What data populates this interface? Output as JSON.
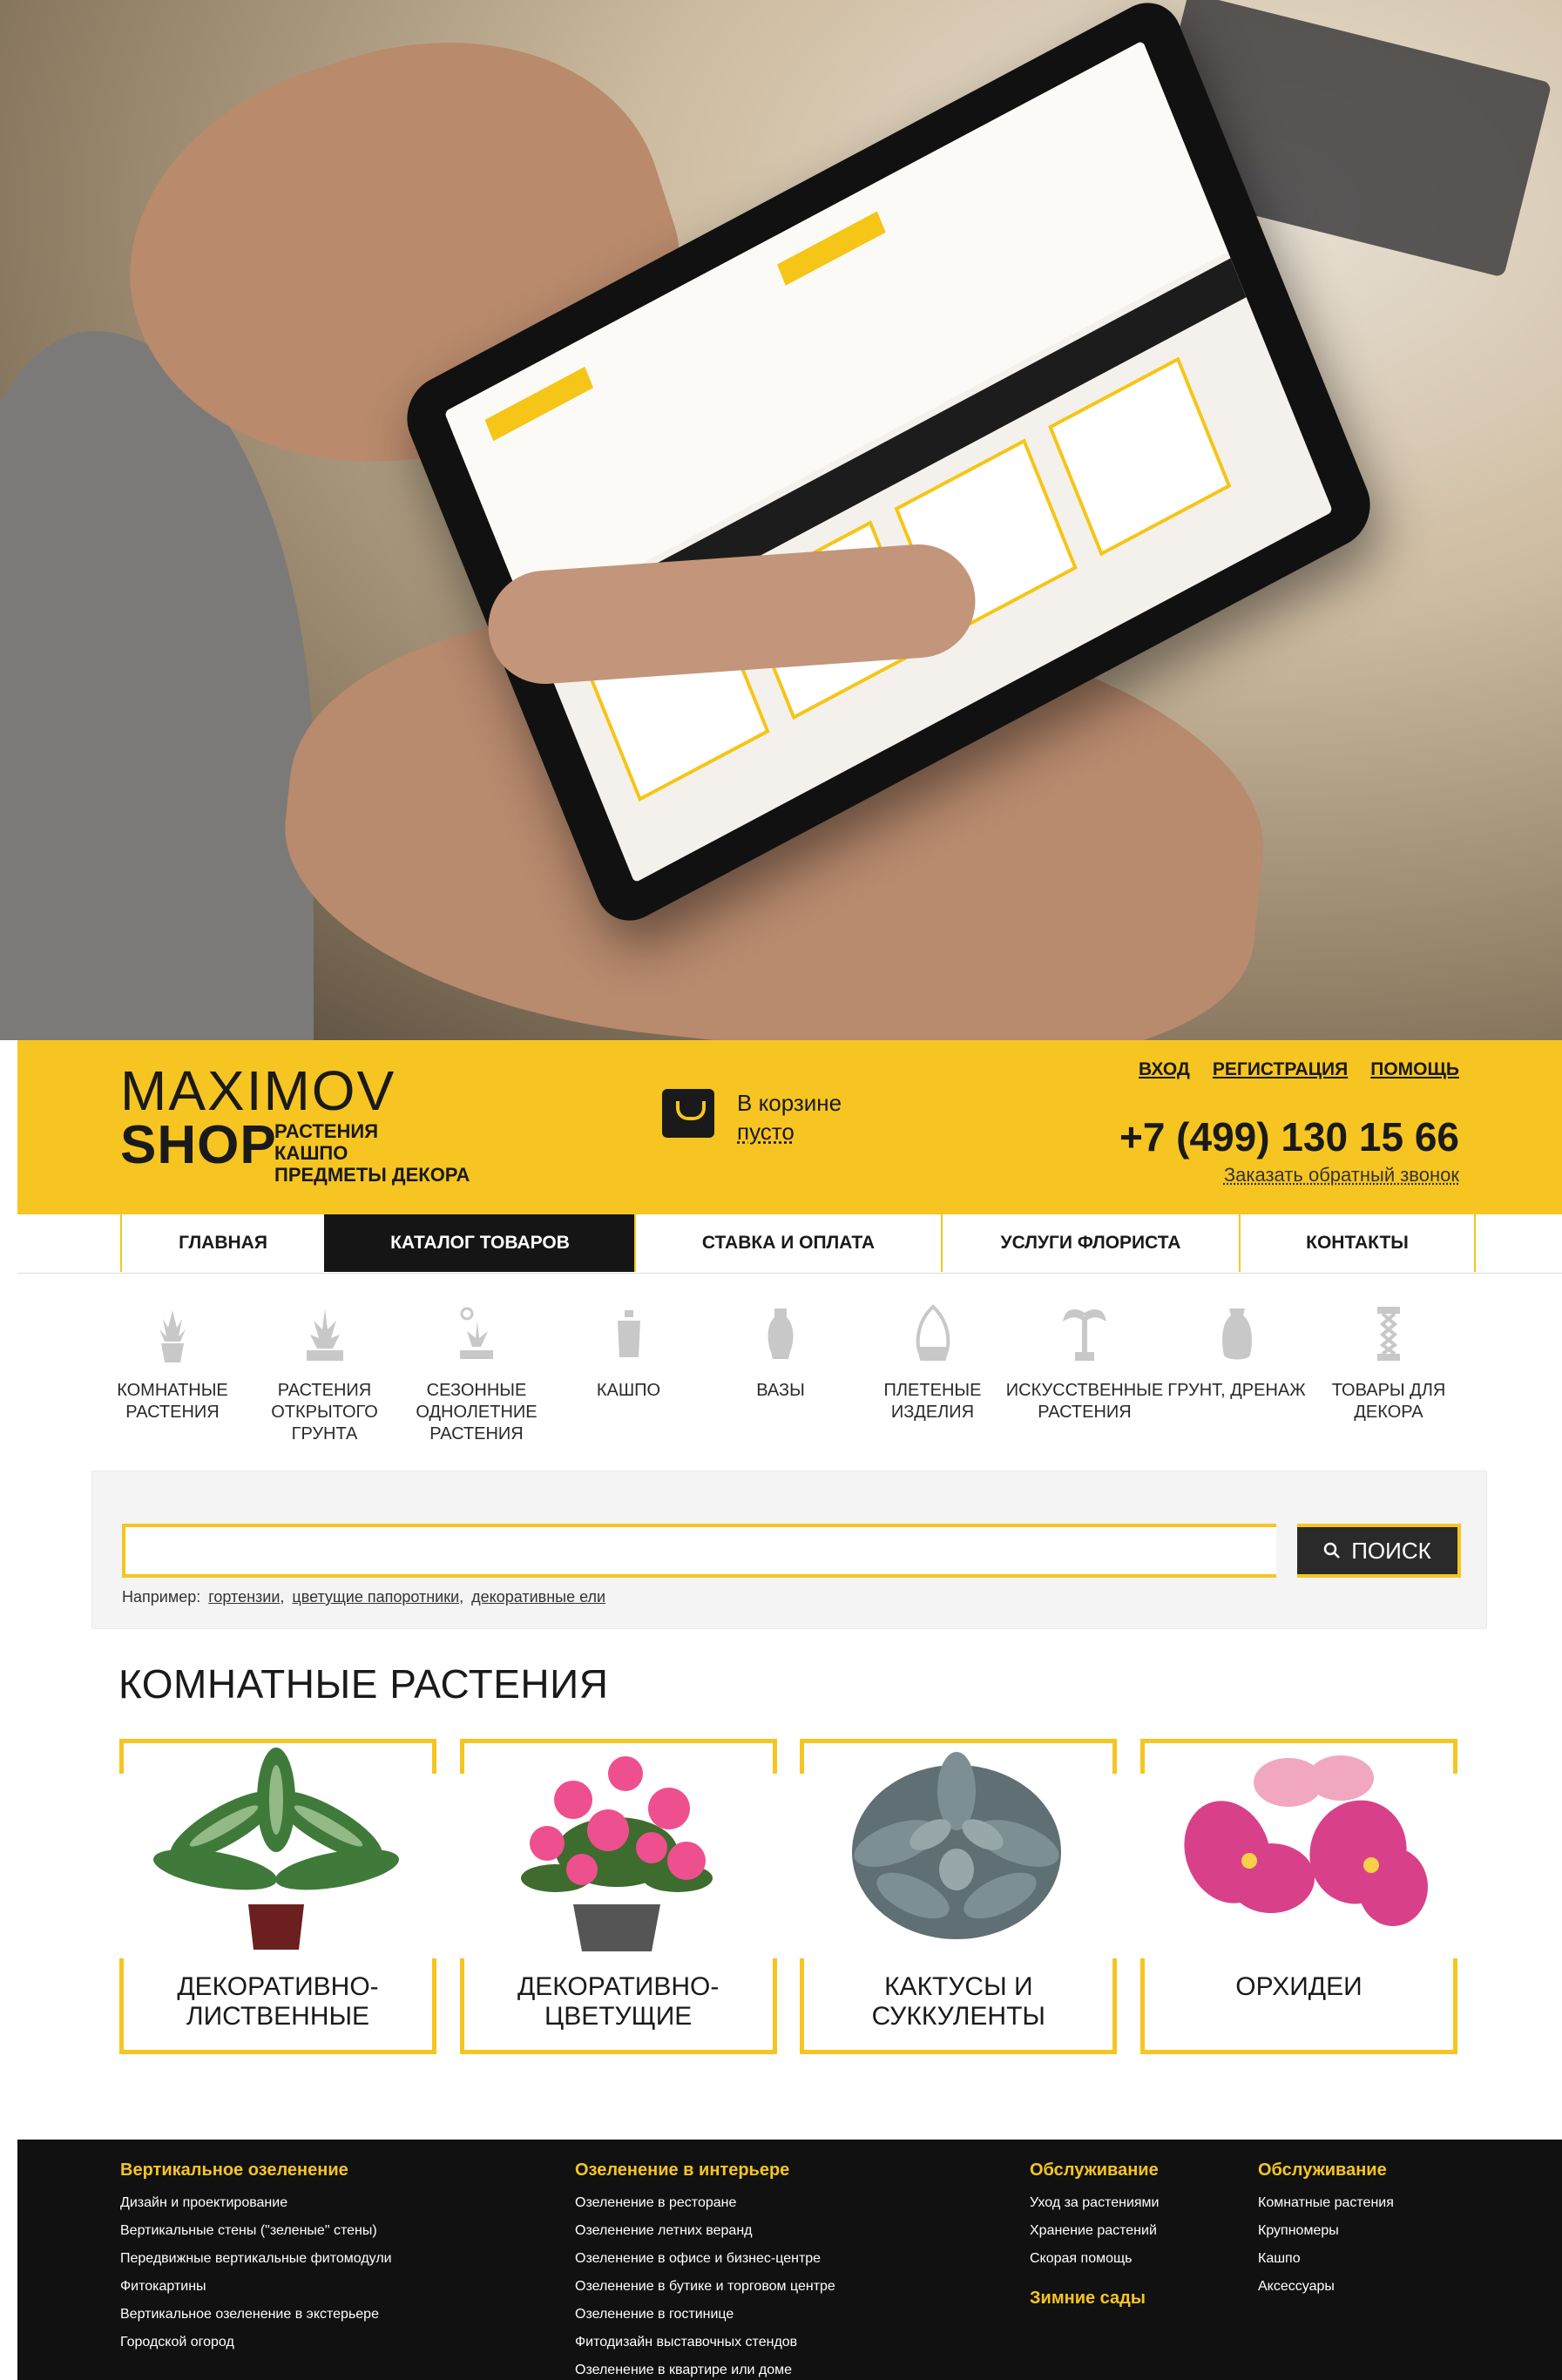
{
  "header": {
    "logo_main": "MAXIMOV",
    "logo_shop": "SHOP",
    "logo_tags": [
      "РАСТЕНИЯ",
      "КАШПО",
      "ПРЕДМЕТЫ ДЕКОРА"
    ],
    "cart_line1": "В корзине",
    "cart_line2": "пусто",
    "links": [
      "ВХОД",
      "РЕГИСТРАЦИЯ",
      "ПОМОЩЬ"
    ],
    "phone": "+7 (499) 130 15 66",
    "callback": "Заказать обратный звонок"
  },
  "nav": {
    "items": [
      {
        "label": "ГЛАВНАЯ",
        "active": false
      },
      {
        "label": "КАТАЛОГ ТОВАРОВ",
        "active": true
      },
      {
        "label": "СТАВКА И ОПЛАТА",
        "active": false
      },
      {
        "label": "УСЛУГИ ФЛОРИСТА",
        "active": false
      },
      {
        "label": "КОНТАКТЫ",
        "active": false
      }
    ]
  },
  "categories": [
    {
      "label": "КОМНАТНЫЕ РАСТЕНИЯ",
      "icon": "potted-plant-icon"
    },
    {
      "label": "РАСТЕНИЯ ОТКРЫТОГО ГРУНТА",
      "icon": "ground-plant-icon"
    },
    {
      "label": "СЕЗОННЫЕ ОДНОЛЕТНИЕ РАСТЕНИЯ",
      "icon": "seasonal-plant-icon"
    },
    {
      "label": "КАШПО",
      "icon": "flowerpot-icon"
    },
    {
      "label": "ВАЗЫ",
      "icon": "vase-icon"
    },
    {
      "label": "ПЛЕТЕНЫЕ ИЗДЕЛИЯ",
      "icon": "wicker-basket-icon"
    },
    {
      "label": "ИСКУССТВЕННЫЕ РАСТЕНИЯ",
      "icon": "palm-tree-icon"
    },
    {
      "label": "ГРУНТ, ДРЕНАЖ",
      "icon": "soil-bag-icon"
    },
    {
      "label": "ТОВАРЫ ДЛЯ ДЕКОРА",
      "icon": "decor-column-icon"
    }
  ],
  "search": {
    "placeholder": "",
    "button_label": "ПОИСК",
    "examples_prefix": "Например:",
    "examples": [
      "гортензии",
      "цветущие папоротники",
      "декоративные ели"
    ]
  },
  "section": {
    "title": "КОМНАТНЫЕ РАСТЕНИЯ",
    "cards": [
      {
        "label": "ДЕКОРАТИВНО-ЛИСТВЕННЫЕ",
        "image": "leafy-plant"
      },
      {
        "label": "ДЕКОРАТИВНО-ЦВЕТУЩИЕ",
        "image": "flowering-plant"
      },
      {
        "label": "КАКТУСЫ И СУККУЛЕНТЫ",
        "image": "succulent"
      },
      {
        "label": "ОРХИДЕИ",
        "image": "orchid"
      }
    ]
  },
  "footer": {
    "columns": [
      {
        "heading": "Вертикальное озеленение",
        "links": [
          "Дизайн и проектирование",
          "Вертикальные стены (\"зеленые\" стены)",
          "Передвижные вертикальные фитомодули",
          "Фитокартины",
          "Вертикальное озеленение в экстерьере",
          "Городской огород"
        ]
      },
      {
        "heading": "Озеленение в интерьере",
        "links": [
          "Озеленение  в ресторане",
          "Озеленение летних веранд",
          "Озеленение в офисе и бизнес-центре",
          "Озеленение в бутике и торговом центре",
          "Озеленение в гостинице",
          "Фитодизайн выставочных стендов",
          "Озеленение в квартире или доме"
        ]
      },
      {
        "heading": "Обслуживание",
        "links": [
          "Уход за растениями",
          "Хранение растений",
          "Скорая помощь"
        ],
        "heading2": "Зимние сады"
      },
      {
        "heading": "Обслуживание",
        "links": [
          "Комнатные растения",
          "Крупномеры",
          "Кашпо",
          "Аксессуары"
        ]
      }
    ]
  },
  "colors": {
    "accent": "#f6c521",
    "dark": "#151515"
  }
}
